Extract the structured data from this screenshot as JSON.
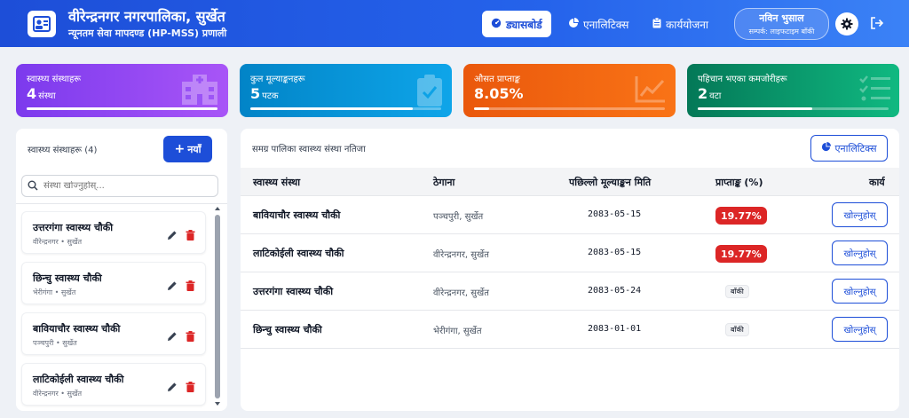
{
  "header": {
    "title": "वीरेन्द्रनगर नगरपालिका, सुर्खेत",
    "subtitle": "न्यूनतम सेवा मापदण्ड (HP-MSS) प्रणाली",
    "nav": {
      "dashboard": "ड्यासबोर्ड",
      "analytics": "एनालिटिक्स",
      "action_plan": "कार्ययोजना"
    },
    "user": {
      "name": "नविन भुसाल",
      "role": "सम्पर्क: लाइफटाइम बाँकी"
    },
    "icons": {
      "logo": "hospital-id-icon",
      "dashboard": "gauge-icon",
      "analytics": "pie-chart-icon",
      "action_plan": "clipboard-icon",
      "settings": "gear-icon",
      "logout": "logout-icon"
    }
  },
  "stats": [
    {
      "label": "स्वास्थ्य संस्थाहरू",
      "value": "4",
      "unit": "संस्था",
      "progress": 1.0,
      "color_from": "#7c3aed",
      "color_to": "#a855f7",
      "icon": "hospital-icon"
    },
    {
      "label": "कुल मूल्याङ्कनहरू",
      "value": "5",
      "unit": "पटक",
      "progress": 0.85,
      "color_from": "#0284c7",
      "color_to": "#0ea5e9",
      "icon": "clipboard-check-icon"
    },
    {
      "label": "औसत प्राप्ताङ्क",
      "value": "8.05%",
      "unit": "",
      "progress": 0.08,
      "color_from": "#ea580c",
      "color_to": "#f97316",
      "icon": "line-chart-icon"
    },
    {
      "label": "पहिचान भएका कमजोरीहरू",
      "value": "2",
      "unit": "वटा",
      "progress": 0.6,
      "color_from": "#047857",
      "color_to": "#10b981",
      "icon": "checklist-icon"
    }
  ],
  "sidebar": {
    "title": "स्वास्थ्य संस्थाहरू (4)",
    "new_button": "नयाँ",
    "search_placeholder": "संस्था खोज्नुहोस्...",
    "items": [
      {
        "name": "उत्तरगंगा स्वास्थ्य चौकी",
        "location": "वीरेन्द्रनगर • सुर्खेत"
      },
      {
        "name": "छिन्चु स्वास्थ्य चौकी",
        "location": "भेरीगंगा • सुर्खेत"
      },
      {
        "name": "बावियाचौर स्वास्थ्य चौकी",
        "location": "पञ्चपुरी • सुर्खेत"
      },
      {
        "name": "लाटिकोईली स्वास्थ्य चौकी",
        "location": "वीरेन्द्रनगर • सुर्खेत"
      }
    ]
  },
  "table": {
    "title": "समग्र पालिका स्वास्थ्य संस्था नतिजा",
    "analytics_button": "एनालिटिक्स",
    "columns": {
      "facility": "स्वास्थ्य संस्था",
      "address": "ठेगाना",
      "last_date": "पछिल्लो मूल्याङ्कन मिति",
      "score": "प्राप्ताङ्क (%)",
      "action": "कार्य"
    },
    "open_label": "खोल्नुहोस्",
    "rows": [
      {
        "name": "बावियाचौर स्वास्थ्य चौकी",
        "address": "पञ्चपुरी, सुर्खेत",
        "date": "2083-05-15",
        "score": "19.77%",
        "badge": "red"
      },
      {
        "name": "लाटिकोईली स्वास्थ्य चौकी",
        "address": "वीरेन्द्रनगर, सुर्खेत",
        "date": "2083-05-15",
        "score": "19.77%",
        "badge": "red"
      },
      {
        "name": "उत्तरगंगा स्वास्थ्य चौकी",
        "address": "वीरेन्द्रनगर, सुर्खेत",
        "date": "2083-05-24",
        "score": "बाँकी",
        "badge": "grey"
      },
      {
        "name": "छिन्चु स्वास्थ्य चौकी",
        "address": "भेरीगंगा, सुर्खेत",
        "date": "2083-01-01",
        "score": "बाँकी",
        "badge": "grey"
      }
    ]
  },
  "colors": {
    "primary": "#1d4ed8",
    "danger": "#dc2626",
    "background": "#eef1f6"
  }
}
